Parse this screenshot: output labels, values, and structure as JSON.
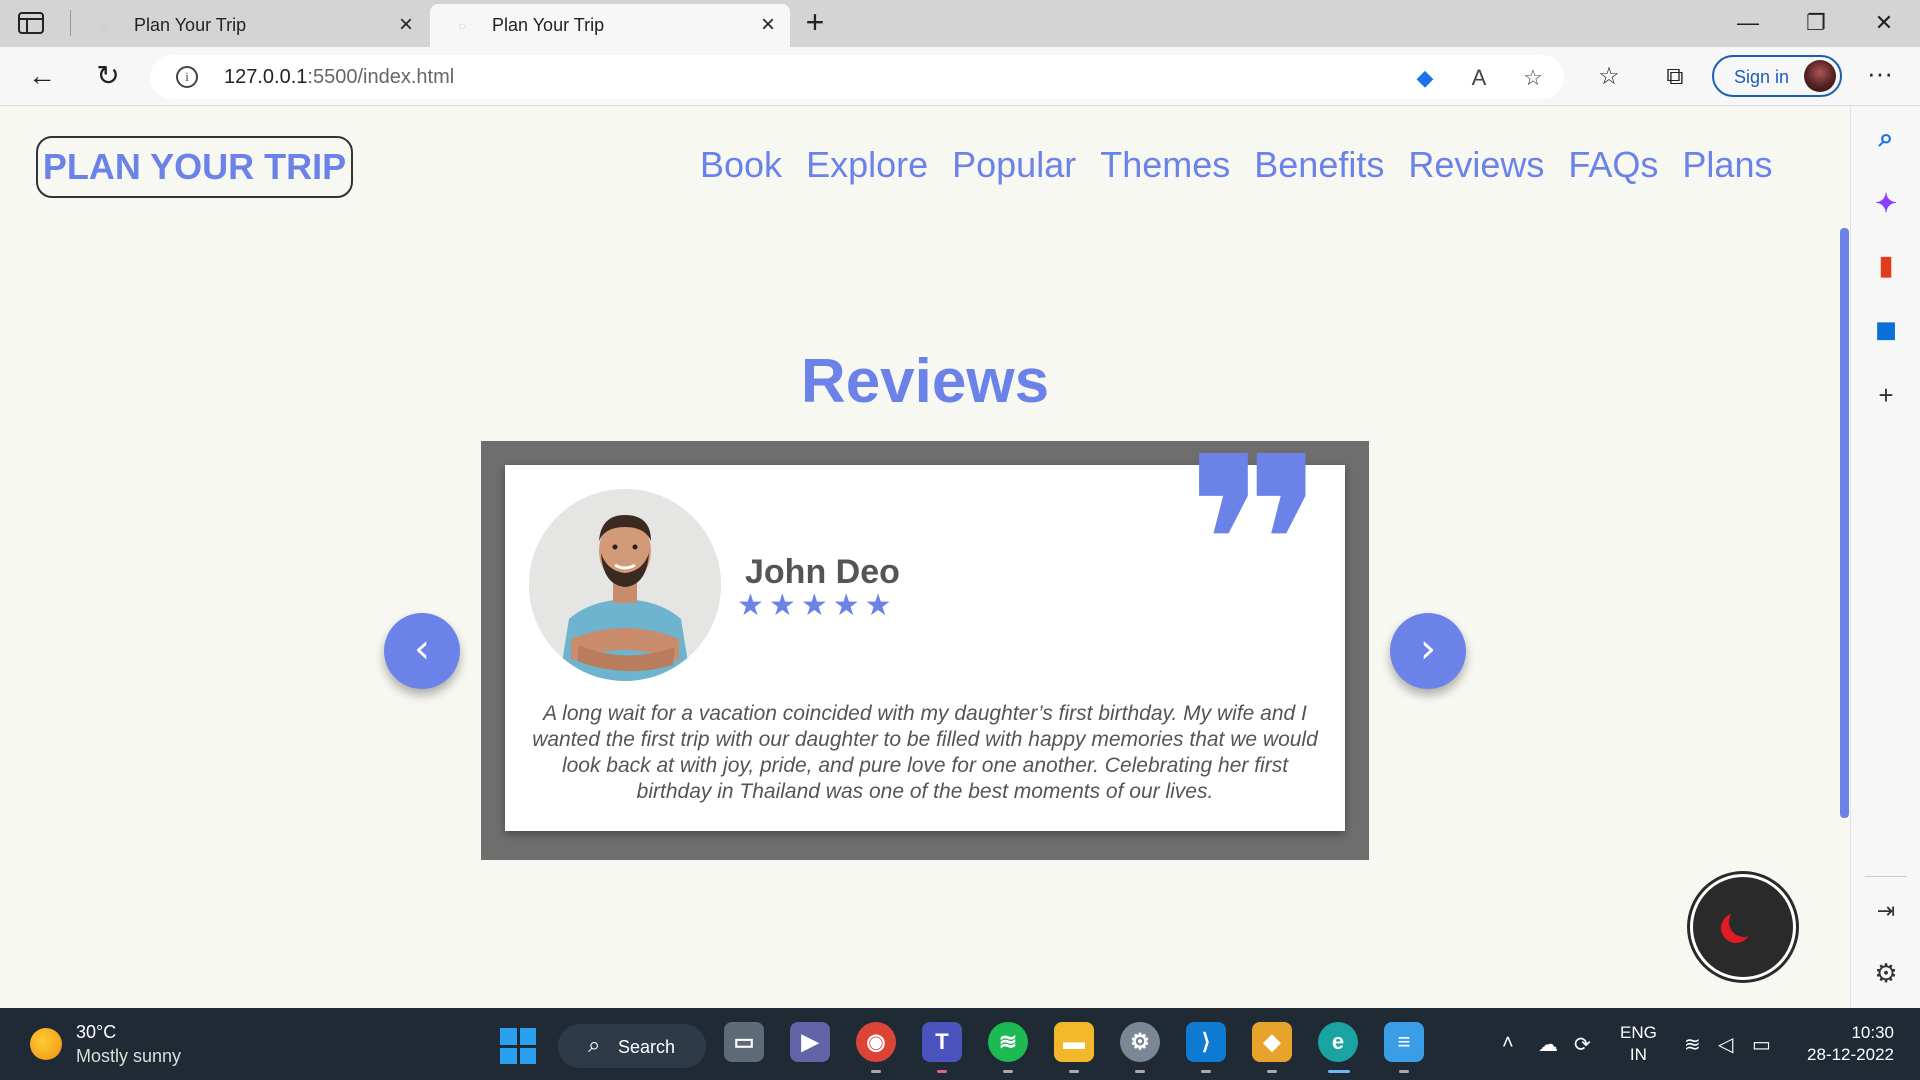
{
  "browser": {
    "tabs": [
      {
        "title": "Plan Your Trip",
        "active": false
      },
      {
        "title": "Plan Your Trip",
        "active": true
      }
    ],
    "url_host": "127.0.0.1",
    "url_path": ":5500/index.html",
    "signin_label": "Sign in"
  },
  "site": {
    "logo": "PLAN YOUR TRIP",
    "nav": [
      "Book",
      "Explore",
      "Popular",
      "Themes",
      "Benefits",
      "Reviews",
      "FAQs",
      "Plans"
    ],
    "section_title": "Reviews",
    "review": {
      "name": "John Deo",
      "rating": 5,
      "quote_glyph": "❞",
      "text": "A long wait for a vacation coincided with my daughter’s first birthday. My wife and I wanted the first trip with our daughter to be filled with happy memories that we would look back at with joy, pride, and pure love for one another. Celebrating her first birthday in Thailand was one of the best moments of our lives."
    },
    "prev_label": "‹",
    "next_label": "›"
  },
  "taskbar": {
    "weather_temp": "30°C",
    "weather_desc": "Mostly sunny",
    "search_label": "Search",
    "lang_top": "ENG",
    "lang_bottom": "IN",
    "time": "10:30",
    "date": "28-12-2022"
  },
  "colors": {
    "accent": "#6b82e8",
    "carousel_bg": "#6e6e6e",
    "page_bg": "#f8f8f2",
    "taskbar_bg": "#1f2a35"
  }
}
